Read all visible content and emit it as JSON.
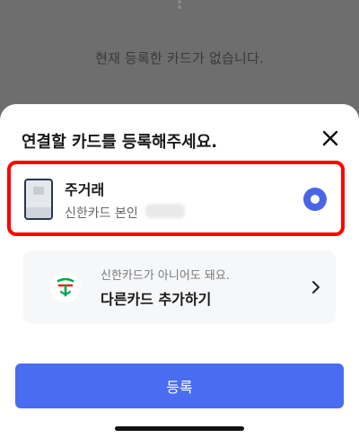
{
  "background": {
    "empty_message": "현재 등록한 카드가 없습니다."
  },
  "sheet": {
    "title": "연결할 카드를 등록해주세요.",
    "close_icon": "close-icon"
  },
  "selected_card": {
    "name": "주거래",
    "description": "신한카드 본인",
    "selected": true,
    "highlight_color": "#ff0000"
  },
  "other_card": {
    "subtitle": "신한카드가 아니어도 돼요.",
    "title": "다른카드 추가하기",
    "logo_icon": "shinhan-logo-icon",
    "chevron_icon": "chevron-right-icon"
  },
  "register_button": {
    "label": "등록",
    "color": "#4a6cf0"
  }
}
